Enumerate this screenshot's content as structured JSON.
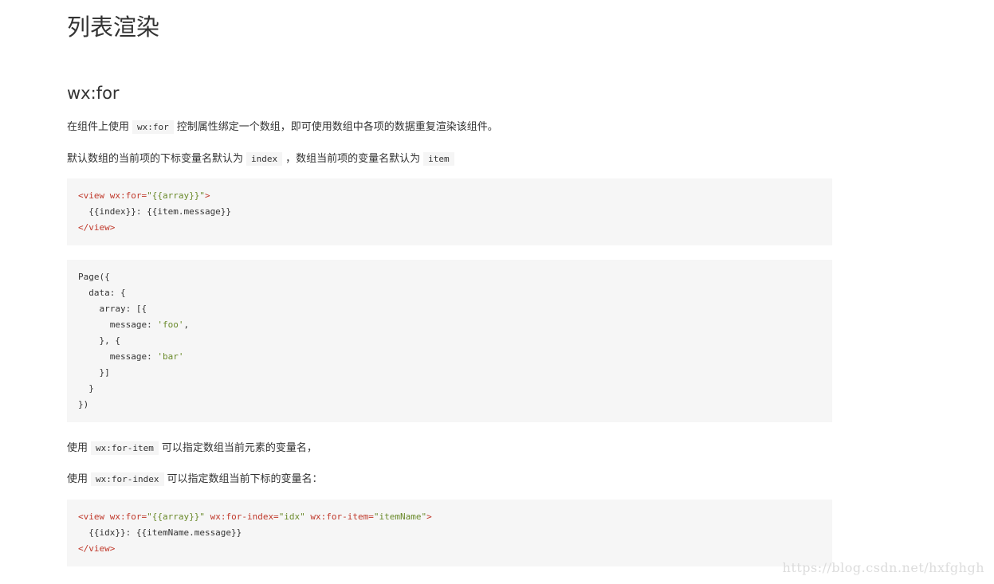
{
  "title": "列表渲染",
  "section": {
    "heading": "wx:for"
  },
  "para1": {
    "before": "在组件上使用",
    "code": "wx:for",
    "after": "控制属性绑定一个数组，即可使用数组中各项的数据重复渲染该组件。"
  },
  "para2": {
    "before": "默认数组的当前项的下标变量名默认为",
    "code1": "index",
    "mid": "，数组当前项的变量名默认为",
    "code2": "item"
  },
  "code1": {
    "l1_tag_open": "<view",
    "l1_attr": " wx:for=",
    "l1_val": "\"{{array}}\"",
    "l1_tag_close": ">",
    "l2": "  {{index}}: {{item.message}}",
    "l3": "</view>"
  },
  "code2": {
    "l1": "Page({",
    "l2": "  data: {",
    "l3": "    array: [{",
    "l4_pre": "      message: ",
    "l4_str": "'foo'",
    "l4_post": ",",
    "l5": "    }, {",
    "l6_pre": "      message: ",
    "l6_str": "'bar'",
    "l7": "    }]",
    "l8": "  }",
    "l9": "})"
  },
  "para3": {
    "before": "使用",
    "code": "wx:for-item",
    "after": "可以指定数组当前元素的变量名，"
  },
  "para4": {
    "before": "使用",
    "code": "wx:for-index",
    "after": "可以指定数组当前下标的变量名："
  },
  "code3": {
    "l1_tag_open": "<view",
    "l1_attr1": " wx:for=",
    "l1_val1": "\"{{array}}\"",
    "l1_attr2": " wx:for-index=",
    "l1_val2": "\"idx\"",
    "l1_attr3": " wx:for-item=",
    "l1_val3": "\"itemName\"",
    "l1_tag_close": ">",
    "l2": "  {{idx}}: {{itemName.message}}",
    "l3": "</view>"
  },
  "watermark": "https://blog.csdn.net/hxfghgh",
  "colors": {
    "tag": "#c0392b",
    "string": "#6a8a2b",
    "code_bg": "#f6f6f6"
  }
}
